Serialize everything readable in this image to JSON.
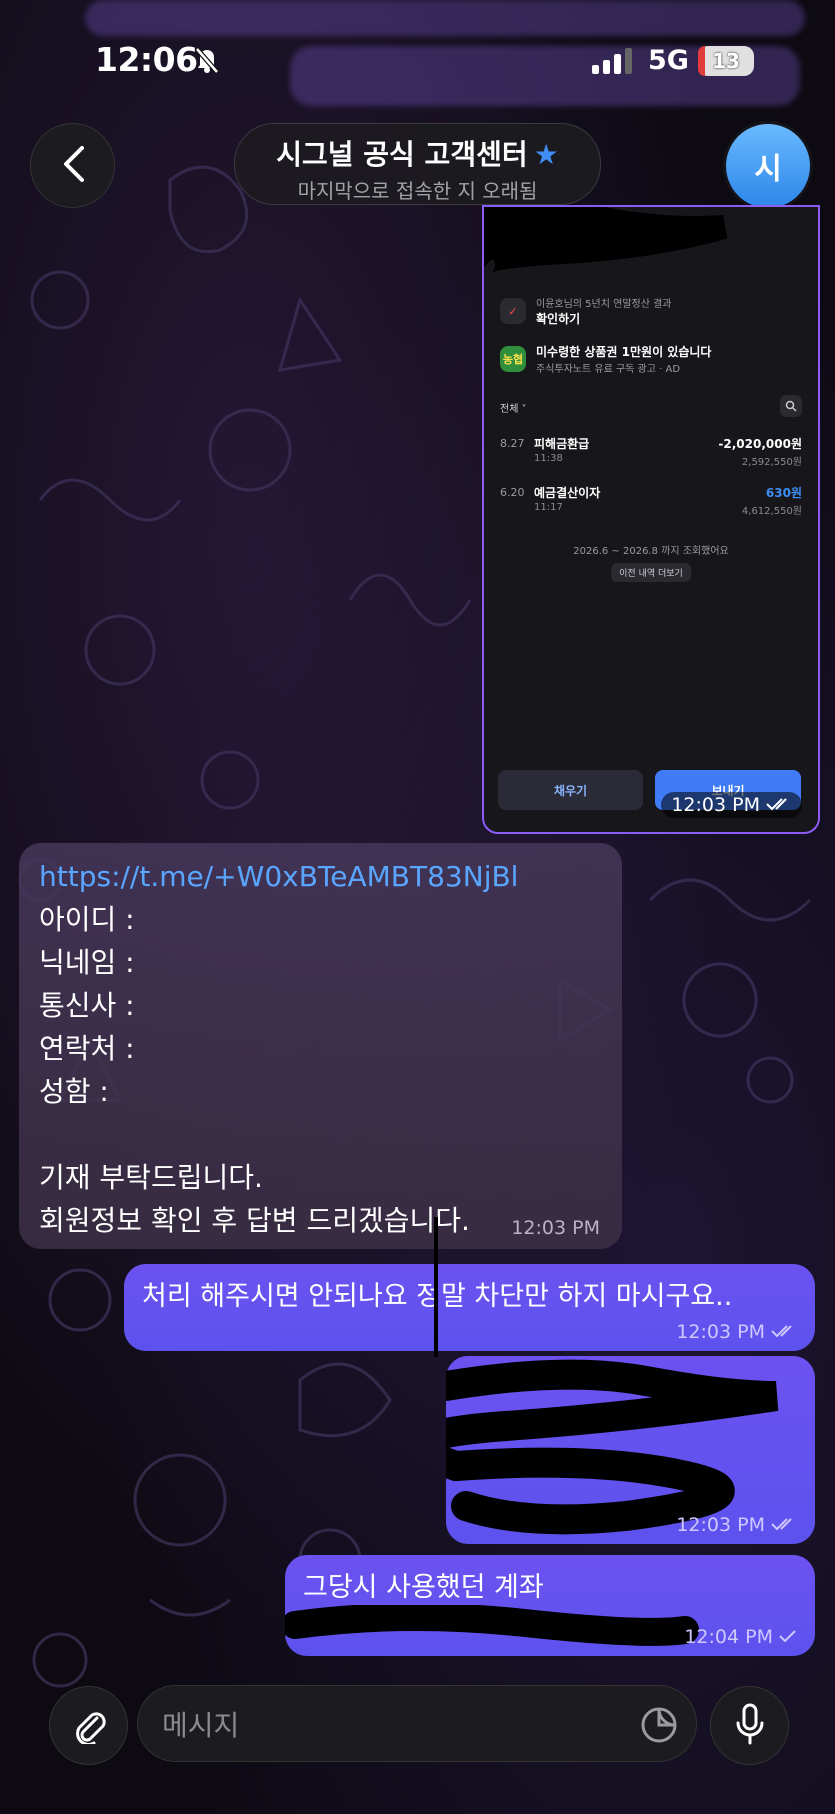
{
  "status_bar": {
    "time": "12:06",
    "network": "5G",
    "battery": "13",
    "battery_level": 0.13
  },
  "header": {
    "title": "시그널 공식 고객센터",
    "subtitle": "마지막으로 접속한 지 오래됨",
    "avatar_letter": "시"
  },
  "image_message": {
    "notice_sub": "이윤호님의 5년치 연말정산 결과",
    "notice_title": "확인하기",
    "bank_badge": "농협",
    "ad_title": "미수령한 상품권 1만원이 있습니다",
    "ad_sub": "주식투자노트 유료 구독 광고 · AD",
    "filter_label": "전체 ˅",
    "transactions": [
      {
        "date": "8.27",
        "label": "피해금환급",
        "time": "11:38",
        "amount": "-2,020,000원",
        "balance": "2,592,550원"
      },
      {
        "date": "6.20",
        "label": "예금결산이자",
        "time": "11:17",
        "amount": "630원",
        "balance": "4,612,550원"
      }
    ],
    "period_text": "2026.6 ~ 2026.8 까지 조회했어요",
    "more_button": "이전 내역 더보기",
    "fill_button": "채우기",
    "send_button": "보내기",
    "time": "12:03 PM"
  },
  "incoming_message": {
    "link": "https://t.me/+W0xBTeAMBT83NjBl",
    "line1": "아이디 :",
    "line2": "닉네임 :",
    "line3": "통신사 :",
    "line4": "연락처 :",
    "line5": "성함 :",
    "line6": "기재 부탁드립니다.",
    "line7": "회원정보 확인 후 답변 드리겠습니다.",
    "time": "12:03 PM"
  },
  "outgoing_messages": [
    {
      "text": "처리 해주시면 안되나요 정말 차단만 하지 마시구요..",
      "time": "12:03 PM"
    },
    {
      "text": "",
      "time": "12:03 PM"
    },
    {
      "text": "그당시 사용했던 계좌",
      "time": "12:04 PM"
    }
  ],
  "input": {
    "placeholder": "메시지"
  },
  "icons": [
    "back-icon",
    "star-icon",
    "bell-off-icon",
    "signal-icon",
    "attach-icon",
    "sticker-icon",
    "mic-icon",
    "double-check-icon",
    "check-icon",
    "search-icon"
  ]
}
